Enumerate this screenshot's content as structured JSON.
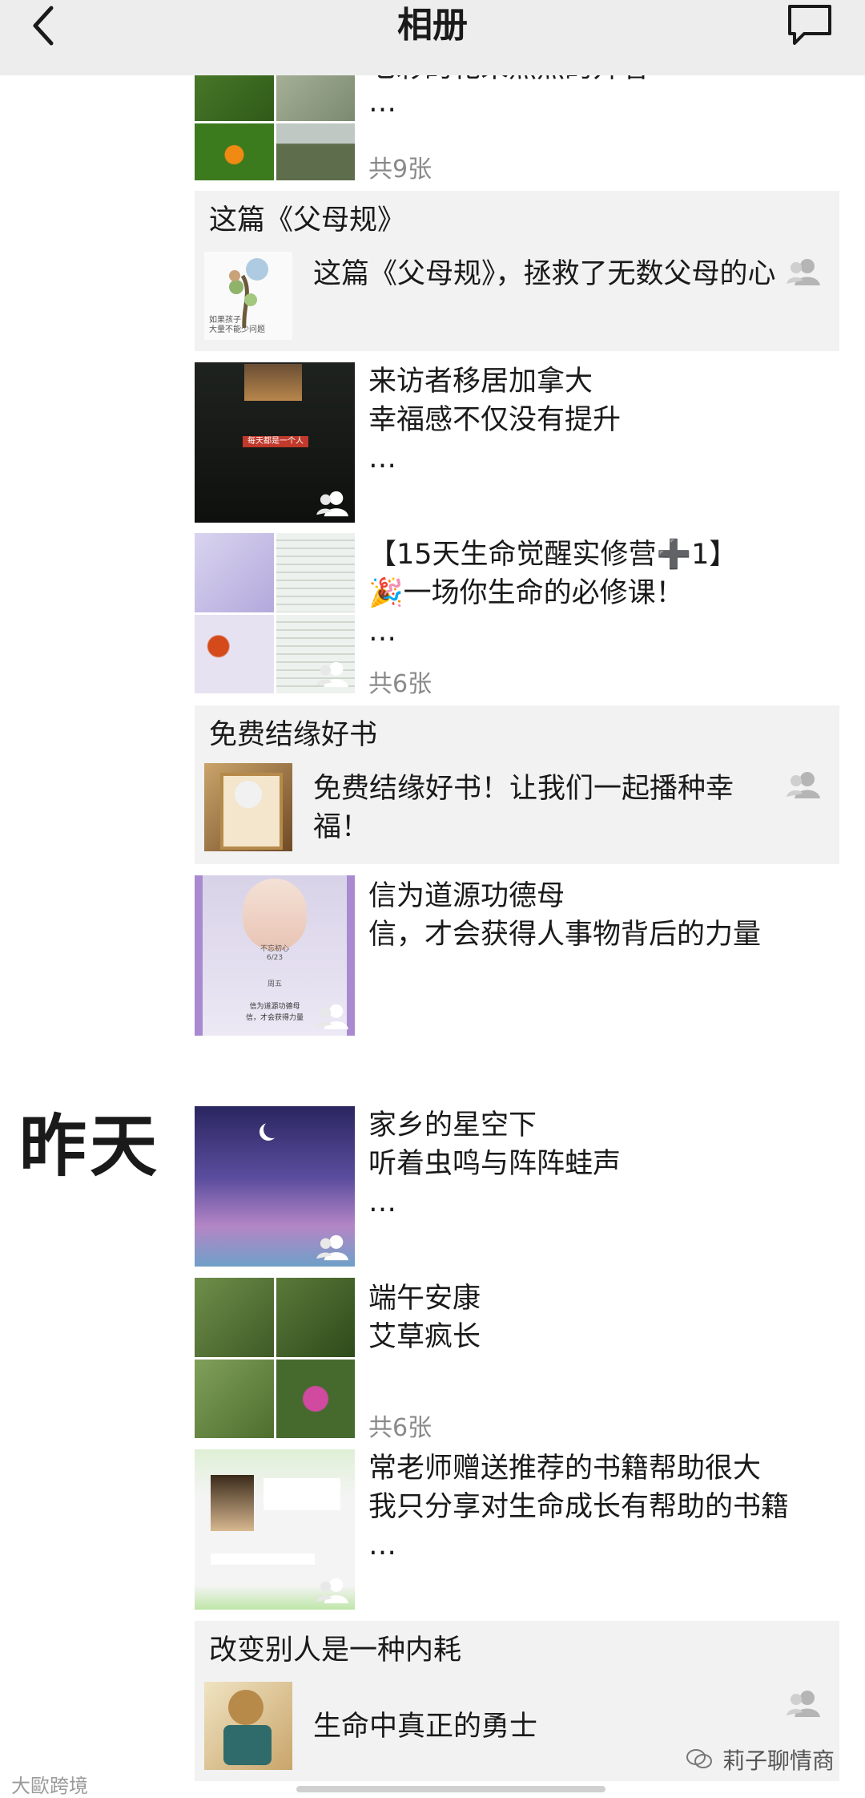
{
  "navbar": {
    "title": "相册"
  },
  "colors": {
    "navbar_bg": "#ededed",
    "share_bg": "#f2f2f2",
    "count_text": "#8a8a8a"
  },
  "today_posts": {
    "post1": {
      "text_line1": "七彩的花朵热烈的开着",
      "ellipsis": "…",
      "count": "共9张"
    },
    "share1": {
      "header": "这篇《父母规》",
      "text": "这篇《父母规》，拯救了无数父母的心",
      "image_caption1": "如果孩子",
      "image_caption2": "大量不能少问题"
    },
    "post2": {
      "line1": "来访者移居加拿大",
      "line2": "幸福感不仅没有提升",
      "ellipsis": "…",
      "image_text1": "每天都是一个人"
    },
    "post3": {
      "line1": "【15天生命觉醒实修营➕1】",
      "line2": "🎉一场你生命的必修课！",
      "ellipsis": "…",
      "count": "共6张"
    },
    "share2": {
      "header": "免费结缘好书",
      "text": "免费结缘好书！让我们一起播种幸福！"
    },
    "post4": {
      "line1": "信为道源功德母",
      "line2": "信，才会获得人事物背后的力量",
      "image_caption1": "信为道源功德母",
      "image_caption2": "信，才会获得力量",
      "image_date": "6/23",
      "image_week": "周五",
      "image_top": "不忘初心"
    }
  },
  "yesterday": {
    "label": "昨天",
    "post1": {
      "line1": "家乡的星空下",
      "line2": "听着虫鸣与阵阵蛙声",
      "ellipsis": "…"
    },
    "post2": {
      "line1": "端午安康",
      "line2": "艾草疯长",
      "count": "共6张"
    },
    "post3": {
      "line1": "常老师赠送推荐的书籍帮助很大",
      "line2": "我只分享对生命成长有帮助的书籍",
      "ellipsis": "…"
    },
    "share3": {
      "header": "改变别人是一种内耗",
      "text": "生命中真正的勇士"
    }
  },
  "watermarks": {
    "left": "大歐跨境",
    "right": "莉子聊情商"
  },
  "icons": [
    "back-chevron-icon",
    "comment-icon",
    "person-icon",
    "wechat-icon"
  ]
}
